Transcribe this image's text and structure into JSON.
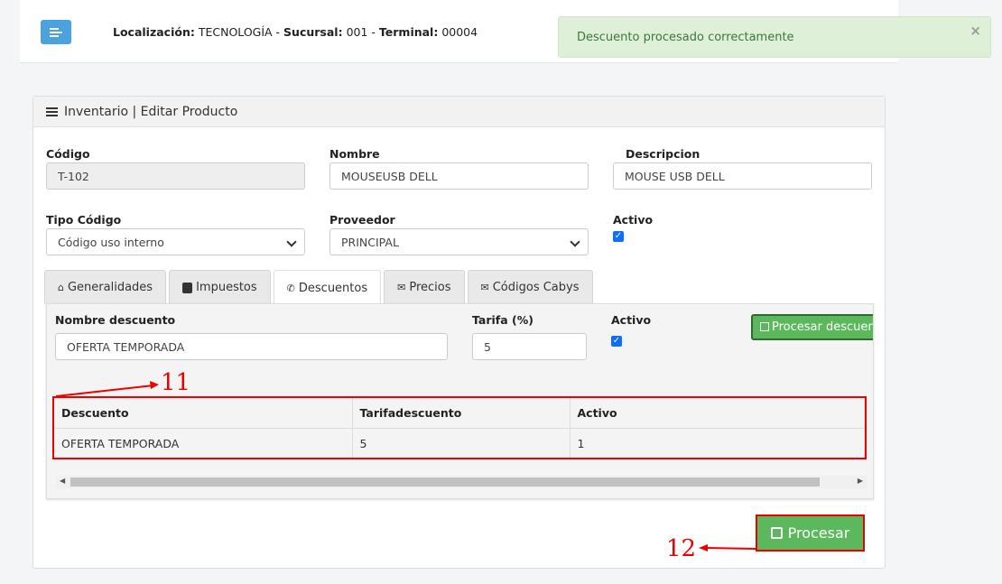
{
  "header": {
    "loc_label": "Localización:",
    "loc_value": "TECNOLOGÍA",
    "suc_label": "Sucursal:",
    "suc_value": "001",
    "term_label": "Terminal:",
    "term_value": "00004"
  },
  "alert": {
    "message": "Descuento procesado correctamente",
    "close": "×"
  },
  "panel": {
    "title": "Inventario | Editar Producto"
  },
  "form": {
    "codigo_label": "Código",
    "codigo_value": "T-102",
    "nombre_label": "Nombre",
    "nombre_value": "MOUSEUSB DELL",
    "descripcion_label": "Descripcion",
    "descripcion_value": "MOUSE USB DELL",
    "tipo_label": "Tipo Código",
    "tipo_value": "Código uso interno",
    "proveedor_label": "Proveedor",
    "proveedor_value": "PRINCIPAL",
    "activo_label": "Activo",
    "activo_checked": true
  },
  "tabs": [
    {
      "label": "Generalidades",
      "icon": "home-icon"
    },
    {
      "label": "Impuestos",
      "icon": "contact-icon"
    },
    {
      "label": "Descuentos",
      "icon": "phone-icon",
      "active": true
    },
    {
      "label": "Precios",
      "icon": "envelope-icon"
    },
    {
      "label": "Códigos Cabys",
      "icon": "envelope-icon"
    }
  ],
  "descuentos": {
    "nombre_label": "Nombre descuento",
    "nombre_value": "OFERTA TEMPORADA",
    "tarifa_label": "Tarifa (%)",
    "tarifa_value": "5",
    "activo_label": "Activo",
    "activo_checked": true,
    "procesar_label": "Procesar descuento",
    "table": {
      "headers": [
        "Descuento",
        "Tarifadescuento",
        "Activo"
      ],
      "rows": [
        [
          "OFERTA TEMPORADA",
          "5",
          "1"
        ]
      ]
    }
  },
  "actions": {
    "procesar_label": "Procesar"
  },
  "annotations": {
    "a11": "11",
    "a12": "12"
  },
  "colors": {
    "primary": "#4aa3df",
    "success": "#5cb85c",
    "annotation": "#e00000",
    "alert_bg": "#dff0d8"
  }
}
